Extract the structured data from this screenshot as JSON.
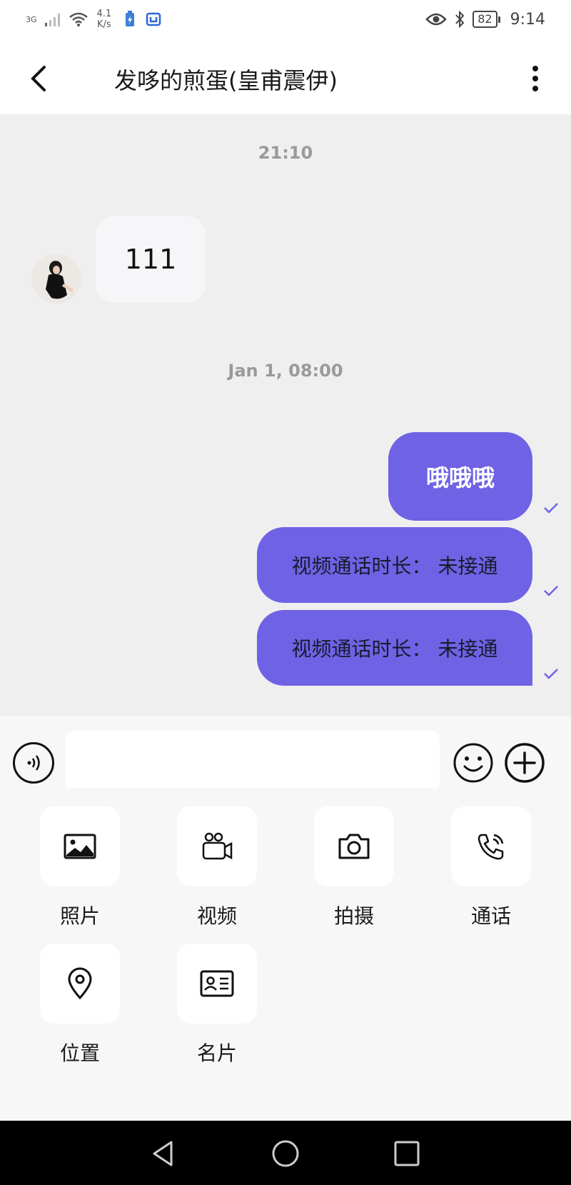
{
  "status_bar": {
    "network": "3G",
    "speed_value": "4.1",
    "speed_unit": "K/s",
    "battery": "82",
    "time": "9:14"
  },
  "header": {
    "title": "发哆的煎蛋(皇甫震伊)"
  },
  "messages": {
    "timestamp_1": "21:10",
    "incoming_1": "111",
    "timestamp_2": "Jan 1, 08:00",
    "outgoing_1": "哦哦哦",
    "outgoing_2": "视频通话时长：  未接通",
    "outgoing_3": "视频通话时长：  未接通"
  },
  "input": {
    "placeholder": ""
  },
  "attachments": [
    {
      "label": "照片",
      "icon": "image-icon"
    },
    {
      "label": "视频",
      "icon": "video-camera-icon"
    },
    {
      "label": "拍摄",
      "icon": "camera-icon"
    },
    {
      "label": "通话",
      "icon": "phone-icon"
    },
    {
      "label": "位置",
      "icon": "location-pin-icon"
    },
    {
      "label": "名片",
      "icon": "contact-card-icon"
    }
  ],
  "colors": {
    "accent": "#6f62e4",
    "background": "#efeff0"
  }
}
